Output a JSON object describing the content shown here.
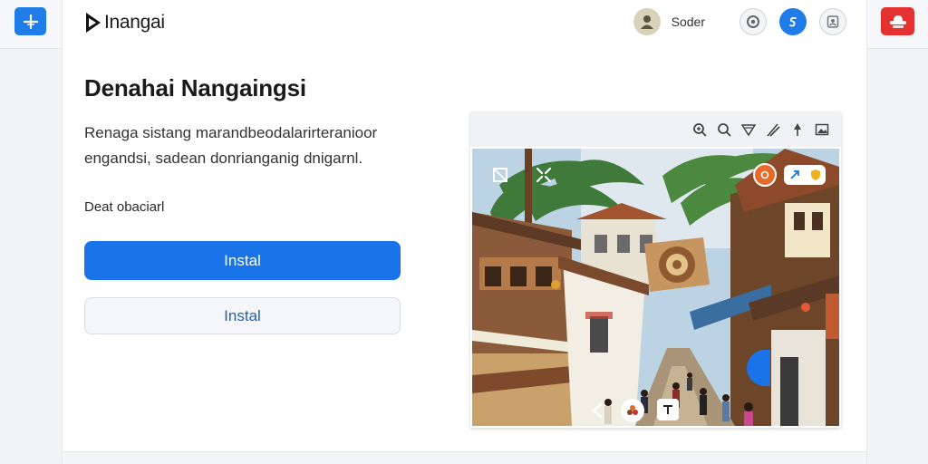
{
  "topbar": {
    "new_tab_icon": "plus-icon",
    "extension_icon": "hat-icon",
    "colors": {
      "blue": "#1f7ce8",
      "red": "#e3322f"
    }
  },
  "header": {
    "logo_text": "Inangai",
    "user_name": "Soder",
    "icons": [
      "avatar",
      "settings-icon",
      "s-badge-icon",
      "account-icon"
    ]
  },
  "main": {
    "title": "Denahai Nangaingsi",
    "description": "Renaga sistang marandbeodalarirteranioor engandsi, sadean donrianganig dnigarnl.",
    "label": "Deat obaciarl",
    "primary_button": "Instal",
    "secondary_button": "Instal"
  },
  "media": {
    "toolbar_icons": [
      "zoom-in-icon",
      "search-icon",
      "filter-icon",
      "draw-icon",
      "pin-icon",
      "image-icon"
    ],
    "overlay_icons": [
      "crop-icon",
      "expand-icon",
      "orange-badge-icon",
      "share-icon",
      "shield-icon",
      "back-icon",
      "flower-icon",
      "text-icon"
    ],
    "accent": "#1a73e8"
  }
}
